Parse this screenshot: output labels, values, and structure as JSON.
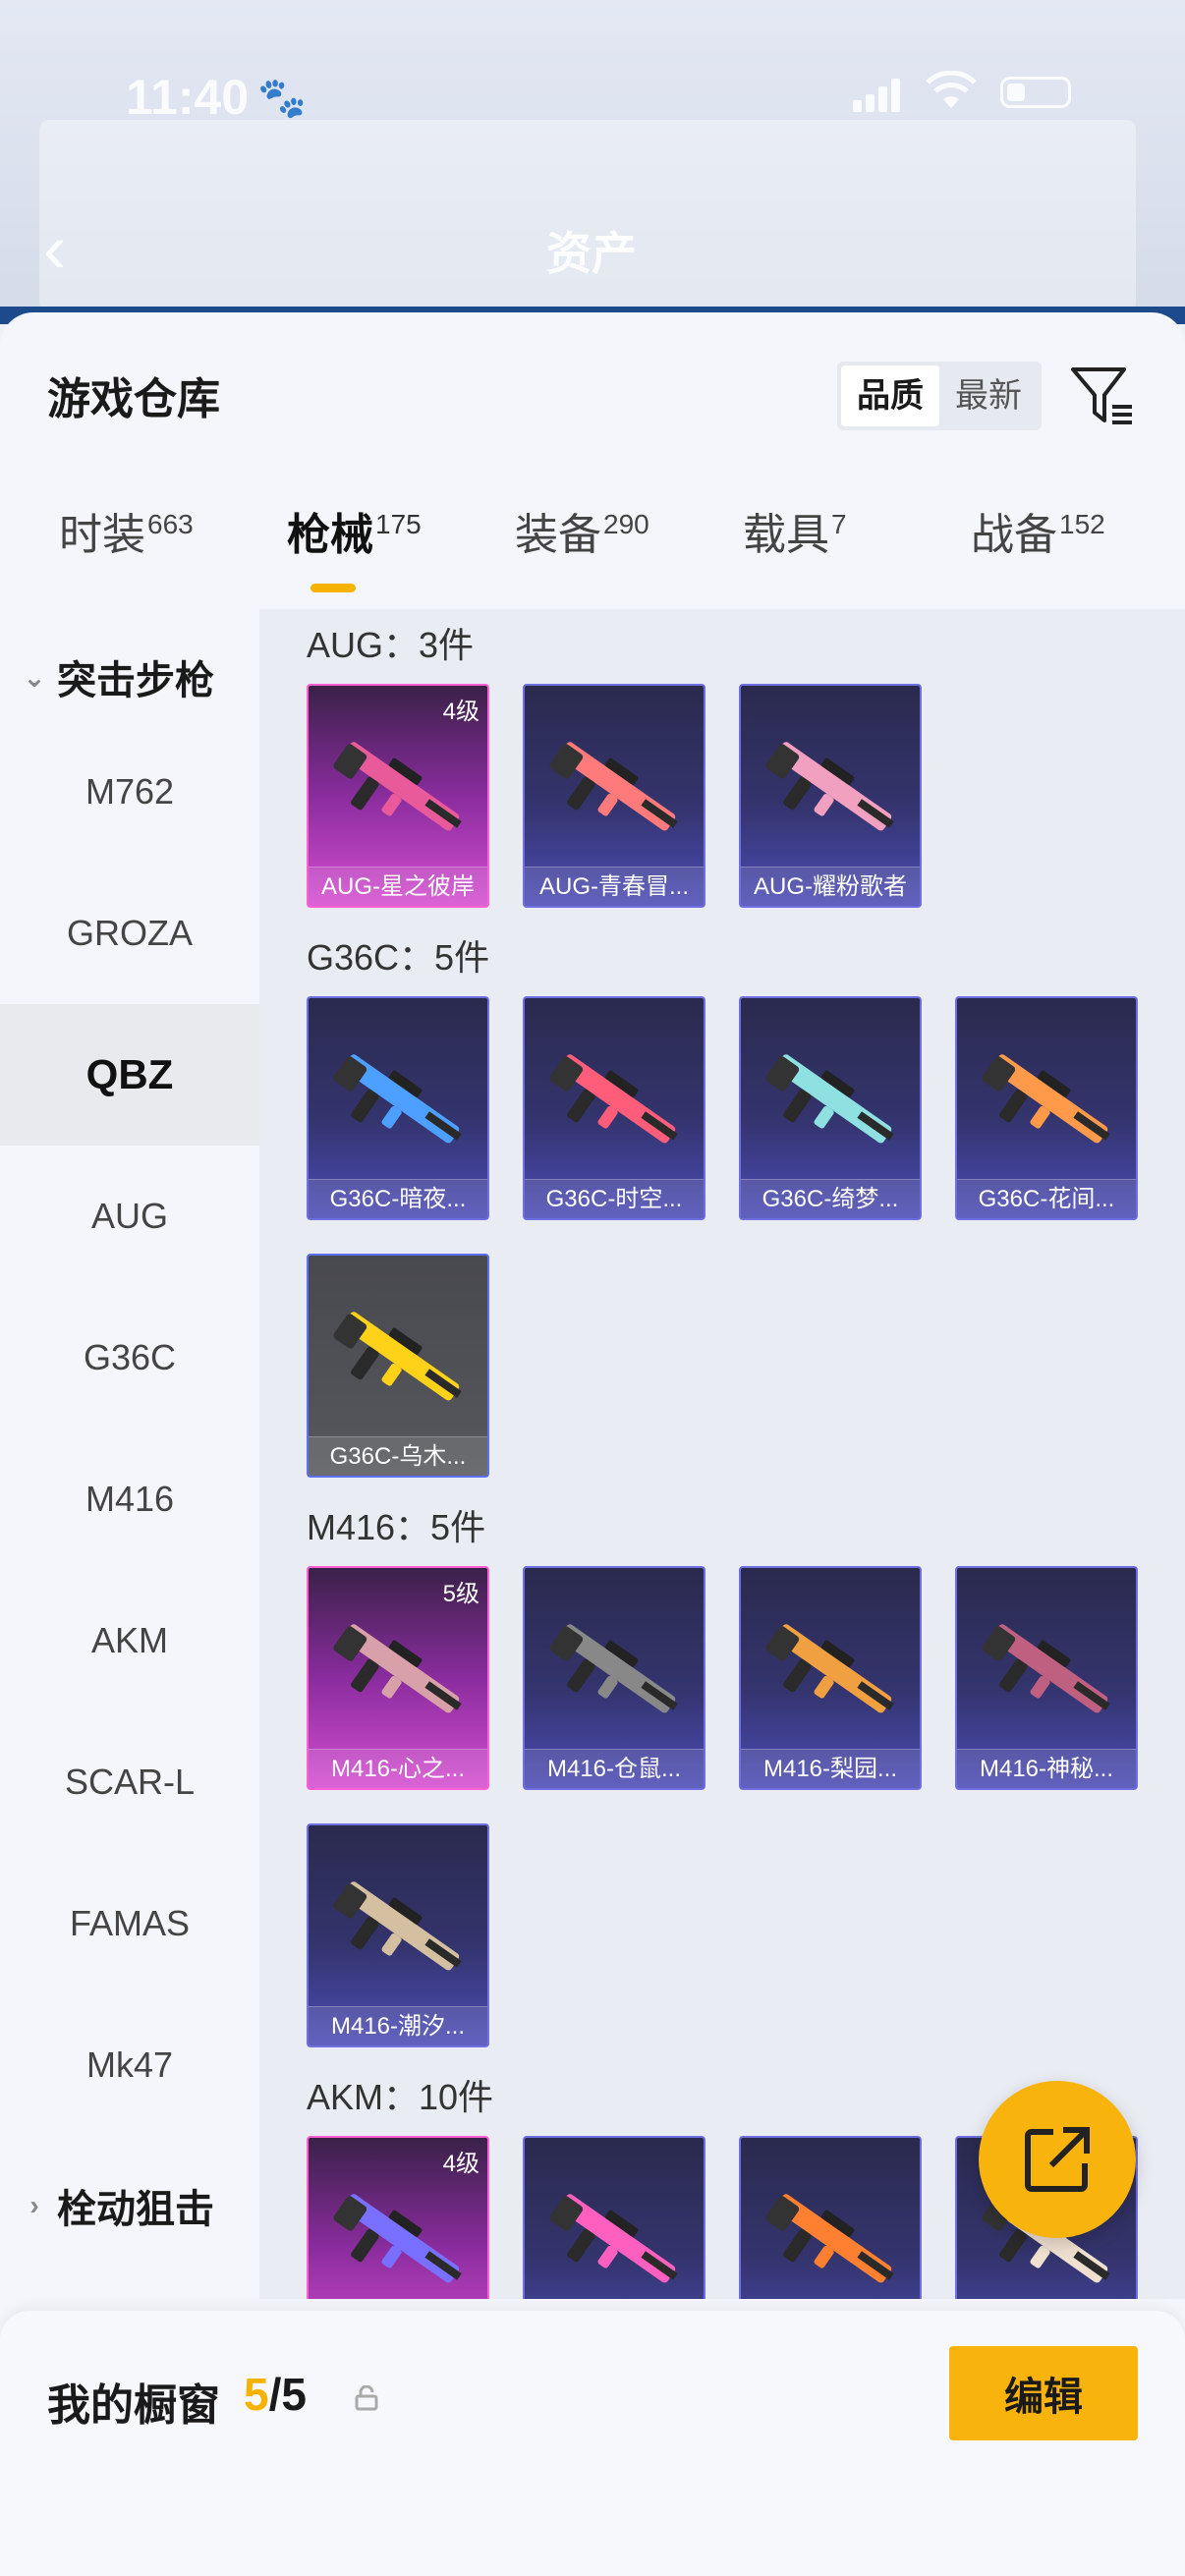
{
  "status_bar": {
    "time": "11:40"
  },
  "header": {
    "title": "资产"
  },
  "sheet": {
    "title": "游戏仓库",
    "sort_options": [
      "品质",
      "最新"
    ],
    "tabs": [
      {
        "label": "时装",
        "count": "663"
      },
      {
        "label": "枪械",
        "count": "175"
      },
      {
        "label": "装备",
        "count": "290"
      },
      {
        "label": "载具",
        "count": "7"
      },
      {
        "label": "战备",
        "count": "152"
      }
    ]
  },
  "sidebar": {
    "groups": [
      "突击步枪",
      "栓动狙击"
    ],
    "items": [
      "M762",
      "GROZA",
      "QBZ",
      "AUG",
      "G36C",
      "M416",
      "AKM",
      "SCAR-L",
      "FAMAS",
      "Mk47"
    ]
  },
  "sections": [
    {
      "title": "AUG：3件",
      "items": [
        {
          "name": "AUG-星之彼岸",
          "level": "4级",
          "rarity": "pink"
        },
        {
          "name": "AUG-青春冒...",
          "level": "",
          "rarity": "purple"
        },
        {
          "name": "AUG-耀粉歌者",
          "level": "",
          "rarity": "purple"
        }
      ]
    },
    {
      "title": "G36C：5件",
      "items": [
        {
          "name": "G36C-暗夜...",
          "level": "",
          "rarity": "purple"
        },
        {
          "name": "G36C-时空...",
          "level": "",
          "rarity": "purple"
        },
        {
          "name": "G36C-绮梦...",
          "level": "",
          "rarity": "purple"
        },
        {
          "name": "G36C-花间...",
          "level": "",
          "rarity": "purple"
        },
        {
          "name": "G36C-乌木...",
          "level": "",
          "rarity": "gray"
        }
      ]
    },
    {
      "title": "M416：5件",
      "items": [
        {
          "name": "M416-心之...",
          "level": "5级",
          "rarity": "pink"
        },
        {
          "name": "M416-仓鼠...",
          "level": "",
          "rarity": "purple"
        },
        {
          "name": "M416-梨园...",
          "level": "",
          "rarity": "purple"
        },
        {
          "name": "M416-神秘...",
          "level": "",
          "rarity": "purple"
        },
        {
          "name": "M416-潮汐...",
          "level": "",
          "rarity": "purple"
        }
      ]
    },
    {
      "title": "AKM：10件",
      "items": [
        {
          "name": "",
          "level": "4级",
          "rarity": "pink"
        },
        {
          "name": "",
          "level": "",
          "rarity": "purple"
        },
        {
          "name": "",
          "level": "",
          "rarity": "purple"
        },
        {
          "name": "",
          "level": "",
          "rarity": "purple"
        }
      ]
    }
  ],
  "bottom": {
    "label": "我的橱窗",
    "count_current": "5",
    "count_sep": "/5",
    "edit_label": "编辑"
  },
  "colors": {
    "accent": "#f8b30c",
    "rarity_pink": "#ff5fd3",
    "rarity_purple": "#6f6fe0"
  }
}
